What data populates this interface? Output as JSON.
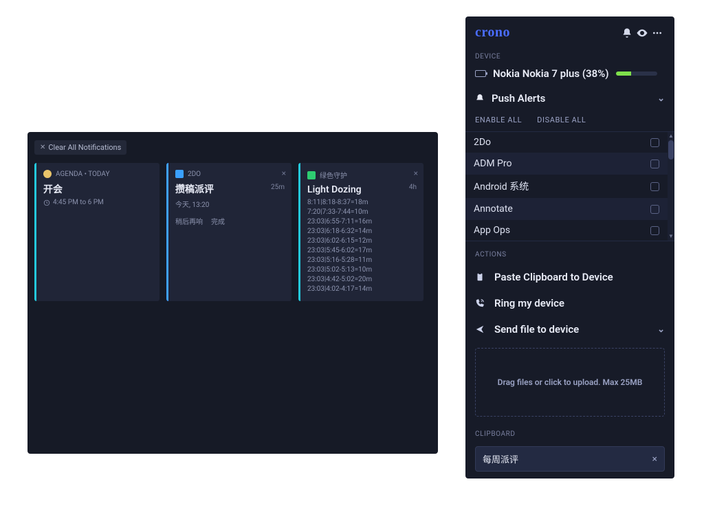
{
  "main": {
    "clear_label": "Clear All Notifications"
  },
  "cards": [
    {
      "app": "AGENDA • TODAY",
      "title": "开会",
      "sub": "4:45 PM to 6 PM"
    },
    {
      "app": "2DO",
      "title": "攒稿派评",
      "sub": "今天, 13:20",
      "right": "25m",
      "action_a": "稍后再响",
      "action_b": "完成"
    },
    {
      "app": "绿色守护",
      "title": "Light Dozing",
      "right": "4h",
      "lines": [
        "8:11|8:18-8:37=18m",
        "7:20|7:33-7:44=10m",
        "23:03|6:55-7:11=16m",
        "23:03|6:18-6:32=14m",
        "23:03|6:02-6:15=12m",
        "23:03|5:45-6:02=17m",
        "23:03|5:16-5:28=11m",
        "23:03|5:02-5:13=10m",
        "23:03|4:42-5:02=20m",
        "23:03|4:02-4:17=14m"
      ]
    }
  ],
  "sidebar": {
    "brand": "crono",
    "device_label": "DEVICE",
    "device_name": "Nokia Nokia 7 plus (38%)",
    "push_label": "Push Alerts",
    "enable_all": "ENABLE ALL",
    "disable_all": "DISABLE ALL",
    "apps": [
      "2Do",
      "ADM Pro",
      "Android 系统",
      "Annotate",
      "App Ops"
    ],
    "actions_label": "ACTIONS",
    "action_paste": "Paste Clipboard to Device",
    "action_ring": "Ring my device",
    "action_send": "Send file to device",
    "dropzone": "Drag files or click to upload. Max 25MB",
    "clipboard_label": "CLIPBOARD",
    "clipboard_value": "每周派评"
  }
}
